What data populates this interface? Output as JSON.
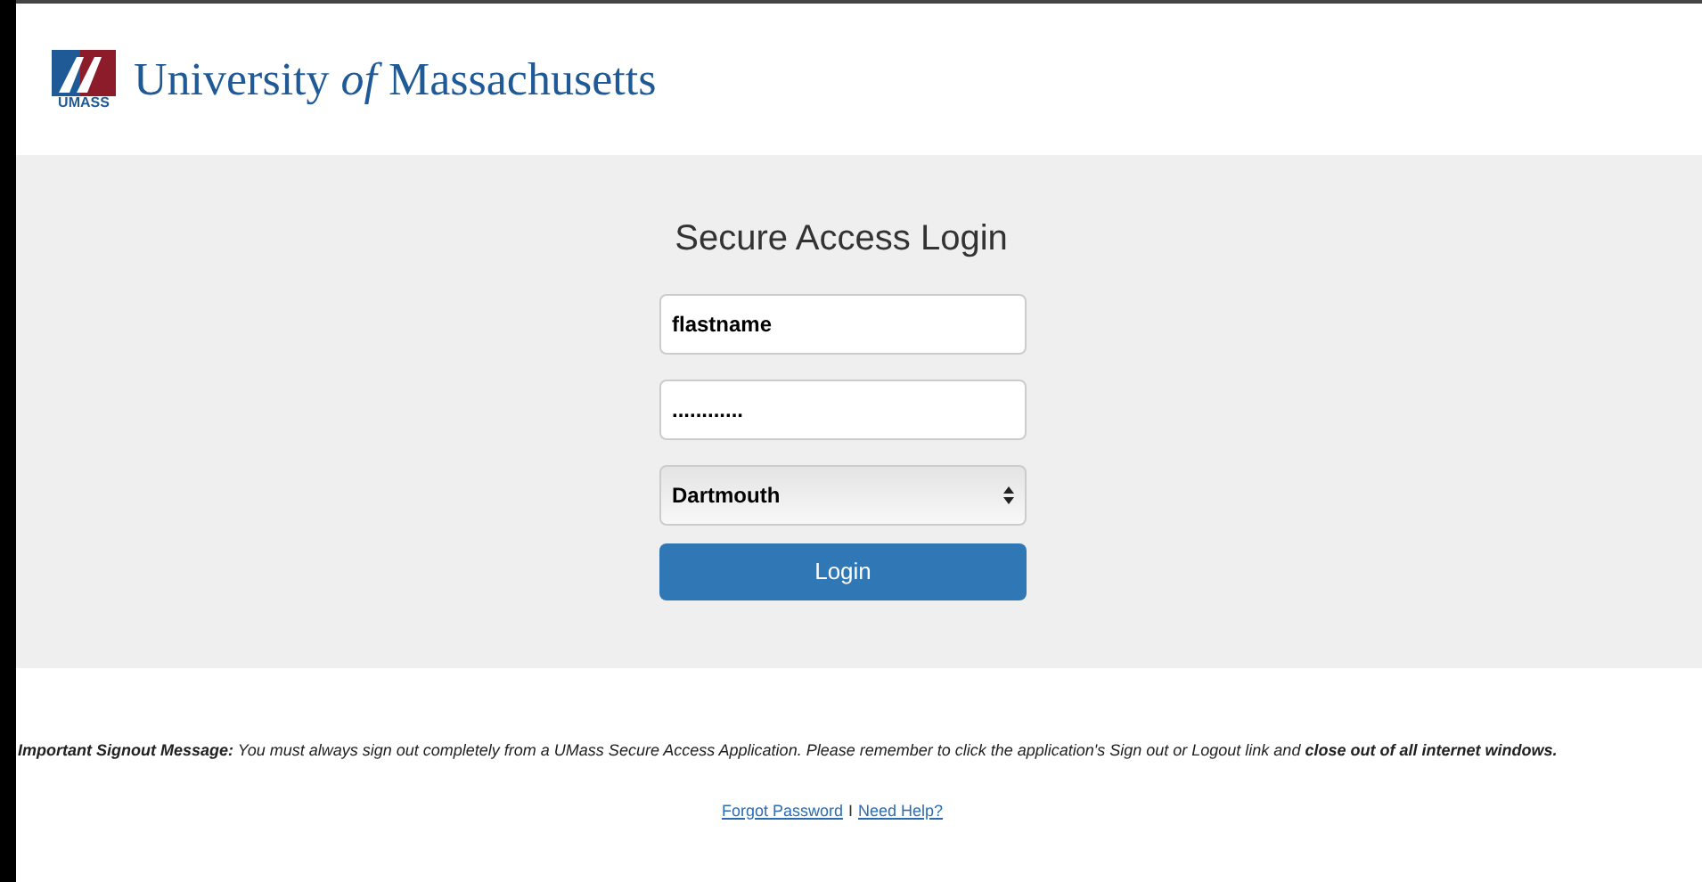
{
  "header": {
    "logo_text": "UMASS",
    "title": "University *of* Massachusetts"
  },
  "login": {
    "title": "Secure Access Login",
    "username": {
      "value": "flastname"
    },
    "password": {
      "value": "............"
    },
    "campus": {
      "value": "Dartmouth"
    },
    "button": "Login"
  },
  "notice": "**Important Signout Message:** You must always sign out completely from a UMass Secure Access Application. Please remember to click the application's Sign out or Logout link and **close out of all internet windows.**",
  "links": [
    {
      "label": "Forgot Password"
    },
    {
      "label": "Need Help?"
    }
  ],
  "link_separator": "I"
}
